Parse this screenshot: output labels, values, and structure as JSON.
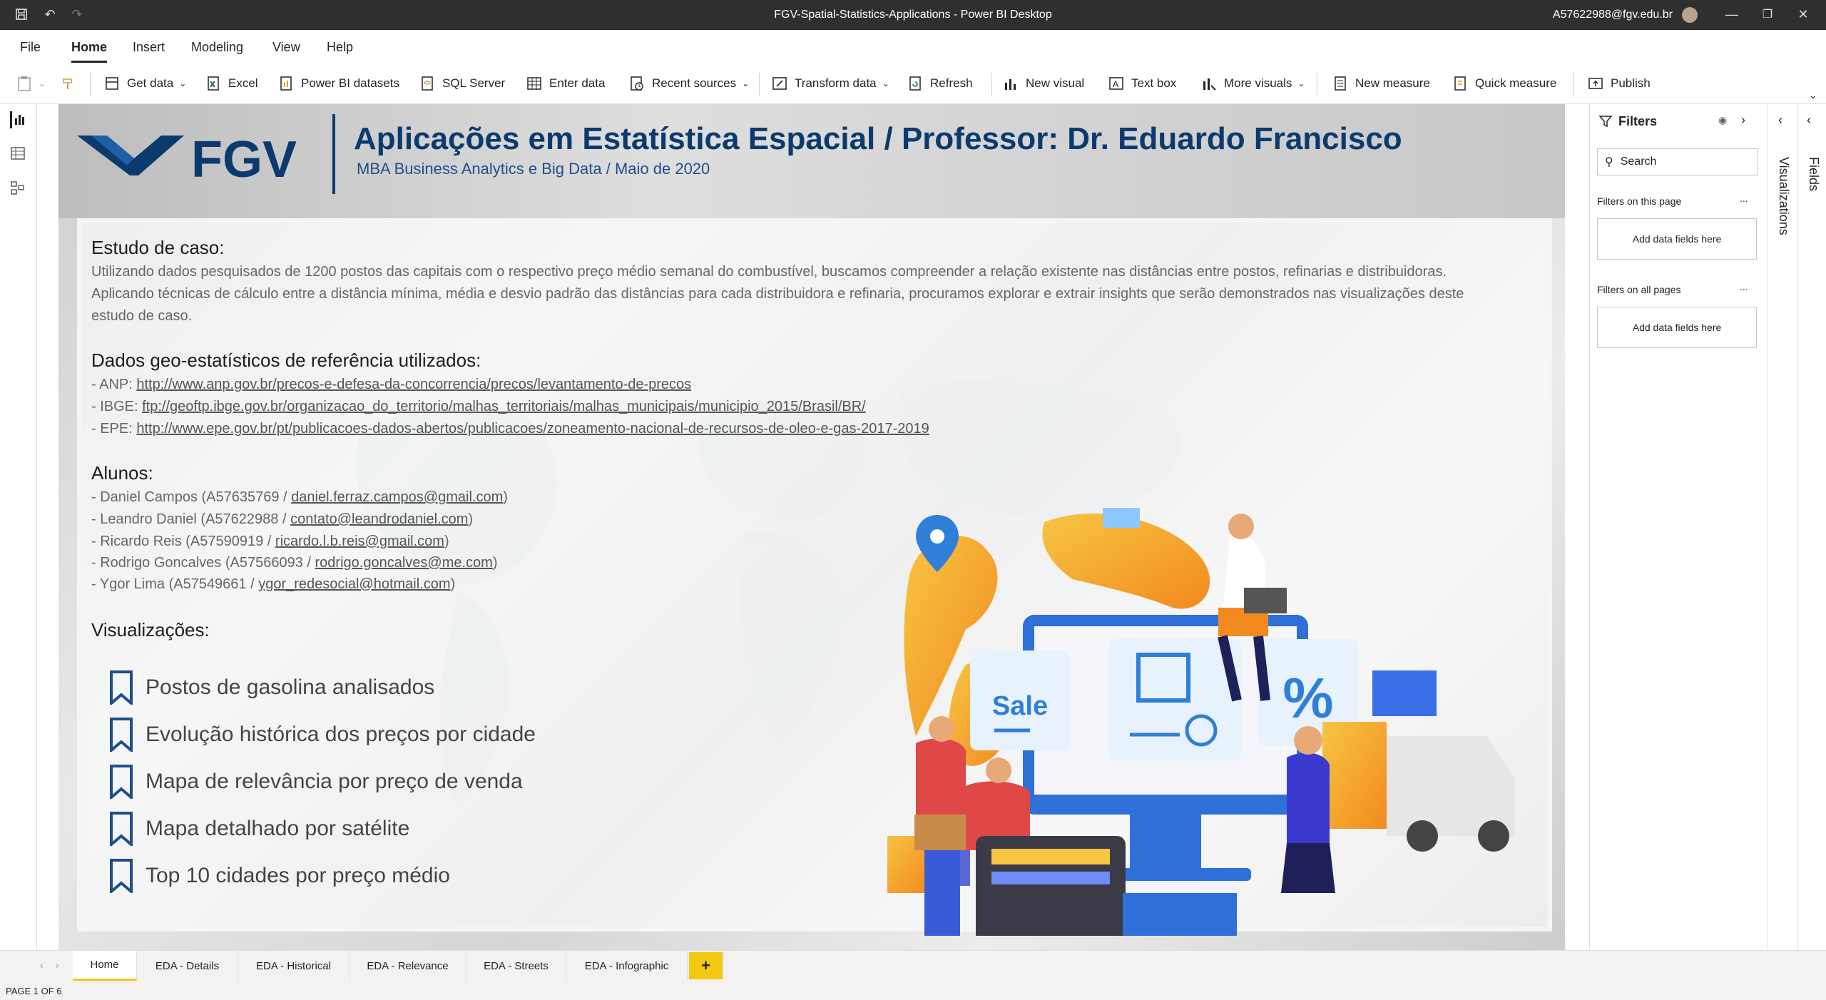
{
  "window": {
    "title": "FGV-Spatial-Statistics-Applications - Power BI Desktop",
    "user": "A57622988@fgv.edu.br"
  },
  "menu": [
    "File",
    "Home",
    "Insert",
    "Modeling",
    "View",
    "Help"
  ],
  "menu_active": "Home",
  "ribbon": {
    "get_data": "Get data",
    "excel": "Excel",
    "pbi_datasets": "Power BI datasets",
    "sql_server": "SQL Server",
    "enter_data": "Enter data",
    "recent_sources": "Recent sources",
    "transform_data": "Transform data",
    "refresh": "Refresh",
    "new_visual": "New visual",
    "text_box": "Text box",
    "more_visuals": "More visuals",
    "new_measure": "New measure",
    "quick_measure": "Quick measure",
    "publish": "Publish"
  },
  "report": {
    "logo_text": "FGV",
    "title": "Aplicações em Estatística Espacial / Professor: Dr. Eduardo Francisco",
    "subtitle": "MBA Business Analytics e Big Data / Maio de 2020",
    "case_heading": "Estudo de caso:",
    "case_lines": [
      "Utilizando dados pesquisados de 1200 postos das capitais com o respectivo preço médio semanal do combustível, buscamos compreender a relação existente nas distâncias entre postos, refinarias e distribuidoras.",
      "Aplicando técnicas de cálculo entre a distância mínima, média e desvio padrão das distâncias para cada distribuidora e refinaria, procuramos explorar e extrair insights que serão demonstrados nas visualizações deste",
      "estudo de caso."
    ],
    "data_heading": "Dados geo-estatísticos de referência utilizados:",
    "sources": [
      {
        "prefix": "- ANP: ",
        "url": "http://www.anp.gov.br/precos-e-defesa-da-concorrencia/precos/levantamento-de-precos"
      },
      {
        "prefix": "- IBGE: ",
        "url": "ftp://geoftp.ibge.gov.br/organizacao_do_territorio/malhas_territoriais/malhas_municipais/municipio_2015/Brasil/BR/"
      },
      {
        "prefix": "- EPE: ",
        "url": "http://www.epe.gov.br/pt/publicacoes-dados-abertos/publicacoes/zoneamento-nacional-de-recursos-de-oleo-e-gas-2017-2019"
      }
    ],
    "students_heading": "Alunos:",
    "students": [
      {
        "prefix": "- Daniel Campos (A57635769 / ",
        "email": "daniel.ferraz.campos@gmail.com",
        "suffix": ")"
      },
      {
        "prefix": "- Leandro Daniel (A57622988 / ",
        "email": "contato@leandrodaniel.com",
        "suffix": ")"
      },
      {
        "prefix": "- Ricardo Reis (A57590919 / ",
        "email": "ricardo.l.b.reis@gmail.com",
        "suffix": ")"
      },
      {
        "prefix": "- Rodrigo Goncalves (A57566093 / ",
        "email": "rodrigo.goncalves@me.com",
        "suffix": ")"
      },
      {
        "prefix": "- Ygor Lima (A57549661 / ",
        "email": "ygor_redesocial@hotmail.com",
        "suffix": ")"
      }
    ],
    "viz_heading": "Visualizações:",
    "visualizations": [
      "Postos de gasolina analisados",
      "Evolução histórica dos preços por cidade",
      "Mapa de relevância por preço de venda",
      "Mapa detalhado por satélite",
      "Top 10 cidades por preço médio"
    ],
    "illustration": {
      "sale": "Sale",
      "percent": "%"
    }
  },
  "filters": {
    "title": "Filters",
    "search_placeholder": "Search",
    "on_page": "Filters on this page",
    "on_all": "Filters on all pages",
    "add_fields": "Add data fields here",
    "more": "..."
  },
  "panes": {
    "visualizations": "Visualizations",
    "fields": "Fields"
  },
  "tabs": [
    "Home",
    "EDA - Details",
    "EDA - Historical",
    "EDA - Relevance",
    "EDA - Streets",
    "EDA - Infographic"
  ],
  "tab_add": "+",
  "status": "PAGE 1 OF 6",
  "colors": {
    "brand_navy": "#0b3a6e",
    "pbi_yellow": "#f2c811"
  }
}
